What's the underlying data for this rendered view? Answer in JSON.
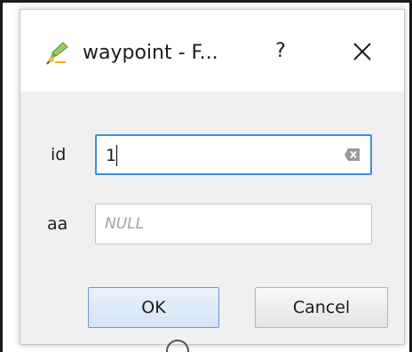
{
  "window": {
    "title": "waypoint - F...",
    "help_label": "?",
    "app_icon": "qgis-edit-icon",
    "close_icon": "close-icon"
  },
  "form": {
    "fields": [
      {
        "label": "id",
        "value": "1",
        "has_clear_button": true,
        "focused": true
      },
      {
        "label": "aa",
        "value": "",
        "placeholder": "NULL"
      }
    ]
  },
  "buttons": {
    "ok_label": "OK",
    "cancel_label": "Cancel"
  },
  "colors": {
    "focus_border": "#3c8de0",
    "ok_border": "#6b9ad4",
    "dialog_bg": "#f0f0f0"
  }
}
